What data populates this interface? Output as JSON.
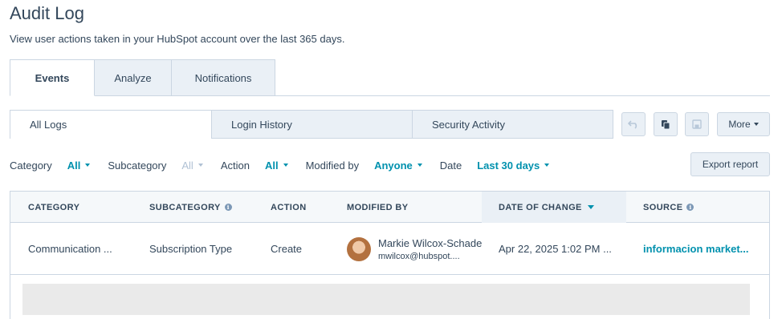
{
  "page": {
    "title": "Audit Log",
    "description": "View user actions taken in your HubSpot account over the last 365 days."
  },
  "main_tabs": [
    {
      "label": "Events",
      "active": true
    },
    {
      "label": "Analyze",
      "active": false
    },
    {
      "label": "Notifications",
      "active": false
    }
  ],
  "sub_tabs": [
    {
      "label": "All Logs",
      "active": true
    },
    {
      "label": "Login History",
      "active": false
    },
    {
      "label": "Security Activity",
      "active": false
    }
  ],
  "toolbar": {
    "undo_icon": "undo-icon",
    "clone_icon": "copy-icon",
    "save_icon": "save-icon",
    "more_label": "More"
  },
  "filters": {
    "category_label": "Category",
    "category_value": "All",
    "subcategory_label": "Subcategory",
    "subcategory_value": "All",
    "action_label": "Action",
    "action_value": "All",
    "modified_by_label": "Modified by",
    "modified_by_value": "Anyone",
    "date_label": "Date",
    "date_value": "Last 30 days",
    "export_label": "Export report"
  },
  "table": {
    "columns": {
      "category": "CATEGORY",
      "subcategory": "SUBCATEGORY",
      "action": "ACTION",
      "modified_by": "MODIFIED BY",
      "date_of_change": "DATE OF CHANGE",
      "source": "SOURCE"
    },
    "sorted_column": "date_of_change",
    "rows": [
      {
        "category": "Communication ...",
        "subcategory": "Subscription Type",
        "action": "Create",
        "user_name": "Markie Wilcox-Schade",
        "user_email": "mwilcox@hubspot....",
        "date": "Apr 22, 2025 1:02 PM ...",
        "source": "informacion market..."
      }
    ]
  },
  "colors": {
    "text": "#33475b",
    "link": "#0091ae",
    "border": "#cbd6e2",
    "tab_bg": "#eaf0f6"
  }
}
